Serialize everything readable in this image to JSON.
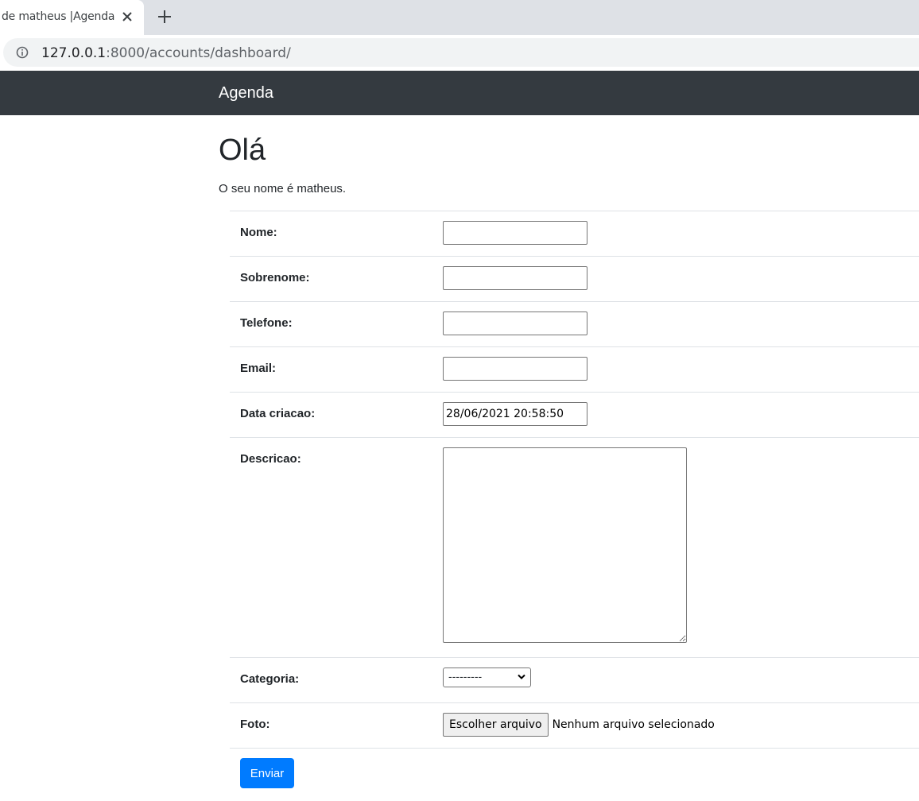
{
  "browser": {
    "tab_title": "de matheus |Agenda",
    "url_host": "127.0.0.1",
    "url_path": ":8000/accounts/dashboard/"
  },
  "navbar": {
    "brand": "Agenda",
    "background": "#343a40"
  },
  "page": {
    "title": "Olá",
    "greeting": "O seu nome é matheus."
  },
  "form": {
    "fields": [
      {
        "label": "Nome:",
        "type": "text",
        "value": ""
      },
      {
        "label": "Sobrenome:",
        "type": "text",
        "value": ""
      },
      {
        "label": "Telefone:",
        "type": "text",
        "value": ""
      },
      {
        "label": "Email:",
        "type": "text",
        "value": ""
      },
      {
        "label": "Data criacao:",
        "type": "text",
        "value": "28/06/2021 20:58:50"
      },
      {
        "label": "Descricao:",
        "type": "textarea",
        "value": ""
      },
      {
        "label": "Categoria:",
        "type": "select",
        "value": "---------"
      },
      {
        "label": "Foto:",
        "type": "file",
        "button": "Escolher arquivo",
        "status": "Nenhum arquivo selecionado"
      }
    ],
    "submit_label": "Enviar",
    "submit_color": "#007bff"
  }
}
